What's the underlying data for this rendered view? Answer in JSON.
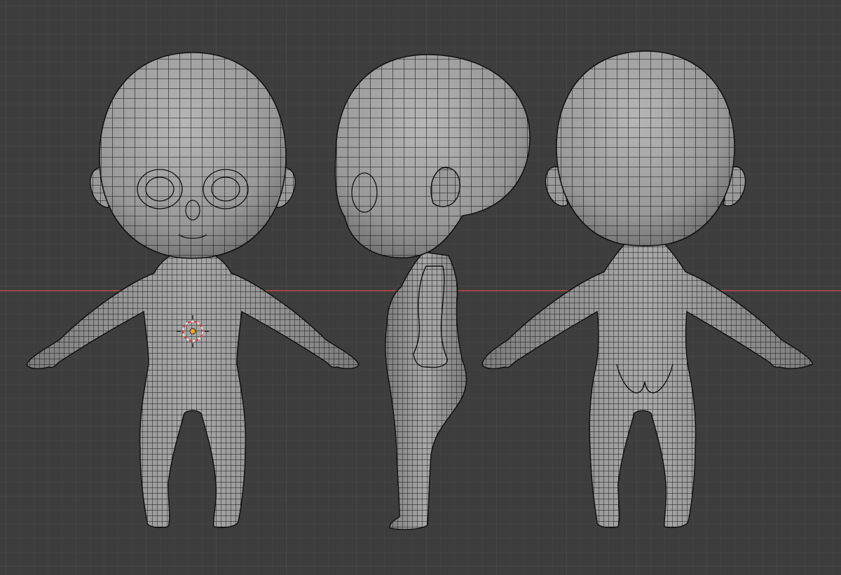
{
  "viewport": {
    "background_color": "#3d3d3d",
    "grid_minor_color": "#464646",
    "grid_major_color": "#4c4c4c",
    "x_axis_color": "#c24a4f",
    "mesh_fill_color": "#9b9b9b",
    "mesh_wire_color": "#0f0f0f",
    "origin_color": "#f0a32a",
    "cursor_ring_colors": [
      "#e8e8e8",
      "#d43c3c"
    ]
  },
  "models": [
    {
      "name": "chibi-front-view",
      "view": "front"
    },
    {
      "name": "chibi-side-view",
      "view": "side"
    },
    {
      "name": "chibi-back-view",
      "view": "back"
    }
  ],
  "icons": {
    "cursor": "3d-cursor-icon",
    "origin": "object-origin-icon"
  }
}
